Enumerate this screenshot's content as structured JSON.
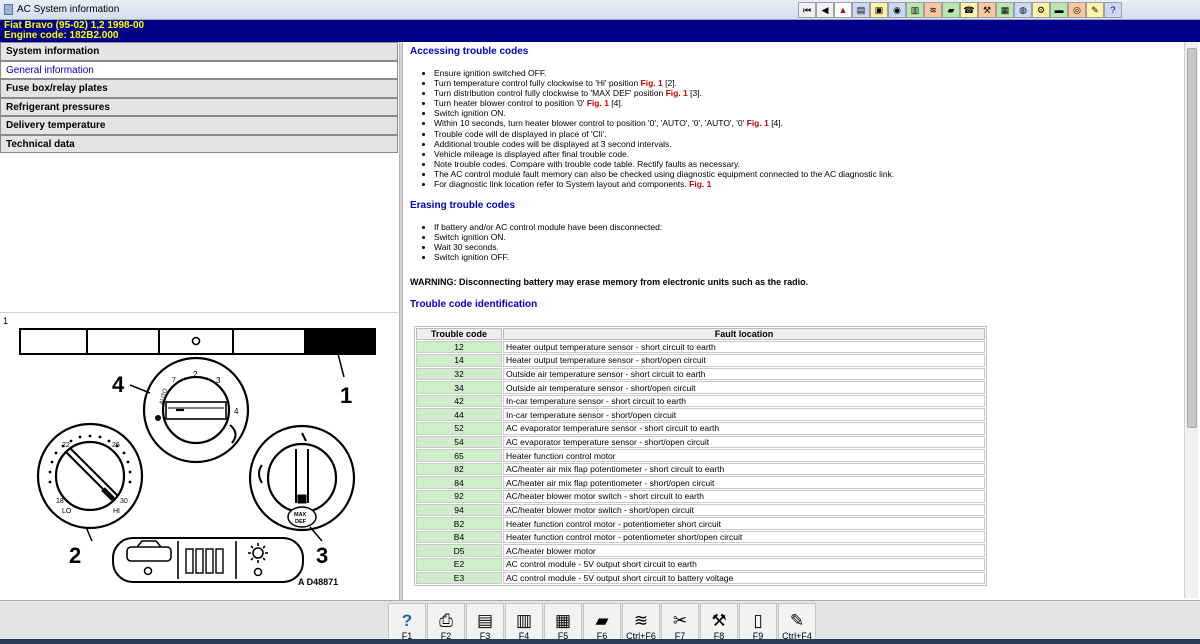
{
  "window": {
    "title": "AC System information"
  },
  "toolbar": {
    "icons": [
      {
        "name": "first-icon",
        "glyph": "⏮"
      },
      {
        "name": "back-icon",
        "glyph": "◀"
      },
      {
        "name": "warning-icon",
        "glyph": "▲"
      },
      {
        "name": "document-icon",
        "glyph": "▤"
      },
      {
        "name": "image-icon",
        "glyph": "▣"
      },
      {
        "name": "component-icon",
        "glyph": "◉"
      },
      {
        "name": "chart-icon",
        "glyph": "▥"
      },
      {
        "name": "wiring-icon",
        "glyph": "≋"
      },
      {
        "name": "vehicle-icon",
        "glyph": "▰"
      },
      {
        "name": "phone-icon",
        "glyph": "☎"
      },
      {
        "name": "tools-icon",
        "glyph": "⚒"
      },
      {
        "name": "data-icon",
        "glyph": "▦"
      },
      {
        "name": "sensor-icon",
        "glyph": "◍"
      },
      {
        "name": "engine-icon",
        "glyph": "⚙"
      },
      {
        "name": "car-icon",
        "glyph": "▬"
      },
      {
        "name": "brake-icon",
        "glyph": "◎"
      },
      {
        "name": "note-icon",
        "glyph": "✎"
      },
      {
        "name": "help-icon",
        "glyph": "?"
      }
    ]
  },
  "vehicle": {
    "model": "Fiat   Bravo (95-02) 1,2   1998-00",
    "engine": "Engine code: 182B2.000"
  },
  "sidebar": {
    "items": [
      {
        "label": "System information",
        "active": false
      },
      {
        "label": "General information",
        "active": true
      },
      {
        "label": "Fuse box/relay plates",
        "active": false
      },
      {
        "label": "Refrigerant pressures",
        "active": false
      },
      {
        "label": "Delivery temperature",
        "active": false
      },
      {
        "label": "Technical data",
        "active": false
      }
    ]
  },
  "figure": {
    "number": "1",
    "code": "A D48871",
    "callouts": [
      "1",
      "2",
      "3",
      "4"
    ],
    "dial_left": {
      "t22": "22",
      "t26": "26",
      "t18": "18",
      "t30": "30",
      "lo": "LO",
      "hi": "HI"
    },
    "dial_top": {
      "t1": "1",
      "t2": "2",
      "t3": "3",
      "t4": "4",
      "t7": "7",
      "auto": "AUTO"
    },
    "dial_right": {
      "max_def": "MAX",
      "def": "DEF"
    }
  },
  "content": {
    "accessing": {
      "heading": "Accessing trouble codes",
      "steps": [
        {
          "text": "Ensure ignition switched OFF.",
          "fig": "",
          "ref": ""
        },
        {
          "text": "Turn temperature control fully clockwise to 'Hi' position ",
          "fig": "Fig. 1",
          "ref": " [2]."
        },
        {
          "text": "Turn distribution control fully clockwise to 'MAX DEF' position ",
          "fig": "Fig. 1",
          "ref": " [3]."
        },
        {
          "text": "Turn heater blower control to position '0' ",
          "fig": "Fig. 1",
          "ref": " [4]."
        },
        {
          "text": "Switch ignition ON.",
          "fig": "",
          "ref": ""
        },
        {
          "text": "Within 10 seconds, turn heater blower control to position '0', 'AUTO', '0', 'AUTO', '0' ",
          "fig": "Fig. 1",
          "ref": " [4]."
        },
        {
          "text": "Trouble code will de displayed in place of 'Cli'.",
          "fig": "",
          "ref": ""
        },
        {
          "text": "Additional trouble codes will be displayed at 3 second intervals.",
          "fig": "",
          "ref": ""
        },
        {
          "text": "Vehicle mileage is displayed after final trouble code.",
          "fig": "",
          "ref": ""
        },
        {
          "text": "Note trouble codes. Compare with trouble code table. Rectify faults as necessary.",
          "fig": "",
          "ref": ""
        },
        {
          "text": "The AC control module fault memory can also be checked using diagnostic equipment connected to the AC diagnostic link.",
          "fig": "",
          "ref": ""
        },
        {
          "text": "For diagnostic link location refer to System layout and components. ",
          "fig": "Fig. 1",
          "ref": ""
        }
      ]
    },
    "erasing": {
      "heading": "Erasing trouble codes",
      "steps": [
        "If battery and/or AC control module have been disconnected:",
        "Switch ignition ON.",
        "Wait 30 seconds.",
        "Switch ignition OFF."
      ]
    },
    "warning": "WARNING: Disconnecting battery may erase memory from electronic units such as the radio.",
    "identification": {
      "heading": "Trouble code identification",
      "col_code": "Trouble code",
      "col_fault": "Fault location",
      "rows": [
        {
          "code": "12",
          "fault": "Heater output temperature sensor - short circuit to earth"
        },
        {
          "code": "14",
          "fault": "Heater output temperature sensor - short/open circuit"
        },
        {
          "code": "32",
          "fault": "Outside air temperature sensor - short circuit to earth"
        },
        {
          "code": "34",
          "fault": "Outside air temperature sensor - short/open circuit"
        },
        {
          "code": "42",
          "fault": "In-car temperature sensor - short circuit to earth"
        },
        {
          "code": "44",
          "fault": "In-car temperature sensor - short/open circuit"
        },
        {
          "code": "52",
          "fault": "AC evaporator temperature sensor - short circuit to earth"
        },
        {
          "code": "54",
          "fault": "AC evaporator temperature sensor - short/open circuit"
        },
        {
          "code": "65",
          "fault": "Heater function control motor"
        },
        {
          "code": "82",
          "fault": "AC/heater air mix flap potentiometer - short circuit to earth"
        },
        {
          "code": "84",
          "fault": "AC/heater air mix flap potentiometer - short/open circuit"
        },
        {
          "code": "92",
          "fault": "AC/heater blower motor switch - short circuit to earth"
        },
        {
          "code": "94",
          "fault": "AC/heater blower motor switch - short/open circuit"
        },
        {
          "code": "B2",
          "fault": "Heater function control motor - potentiometer short circuit"
        },
        {
          "code": "B4",
          "fault": "Heater function control motor - potentiometer short/open circuit"
        },
        {
          "code": "D5",
          "fault": "AC/heater blower motor"
        },
        {
          "code": "E2",
          "fault": "AC control module - 5V output short circuit to earth"
        },
        {
          "code": "E3",
          "fault": "AC control module - 5V output short circuit to battery voltage"
        }
      ]
    }
  },
  "function_keys": [
    {
      "label": "F1",
      "icon": "help-icon",
      "glyph": "?"
    },
    {
      "label": "F2",
      "icon": "print-icon",
      "glyph": "⎙"
    },
    {
      "label": "F3",
      "icon": "print-list-icon",
      "glyph": "▤"
    },
    {
      "label": "F4",
      "icon": "print-page-icon",
      "glyph": "▥"
    },
    {
      "label": "F5",
      "icon": "document-icon",
      "glyph": "▦"
    },
    {
      "label": "F6",
      "icon": "module-icon",
      "glyph": "▰"
    },
    {
      "label": "Ctrl+F6",
      "icon": "wiring-icon",
      "glyph": "≋"
    },
    {
      "label": "F7",
      "icon": "tools-icon",
      "glyph": "✂"
    },
    {
      "label": "F8",
      "icon": "mechanic-icon",
      "glyph": "⚒"
    },
    {
      "label": "F9",
      "icon": "book-icon",
      "glyph": "▯"
    },
    {
      "label": "Ctrl+F4",
      "icon": "notes-icon",
      "glyph": "✎"
    }
  ]
}
